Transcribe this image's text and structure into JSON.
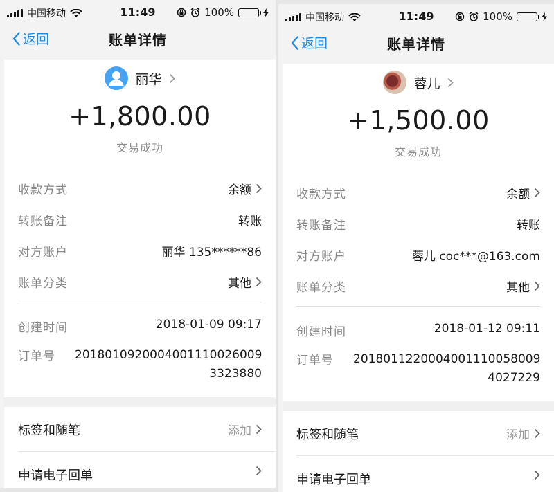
{
  "screens": [
    {
      "status_bar": {
        "carrier": "中国移动",
        "time": "11:49",
        "battery": "100%"
      },
      "nav": {
        "back_label": "返回",
        "title": "账单详情"
      },
      "contact": {
        "name": "丽华"
      },
      "amount": "+1,800.00",
      "status": "交易成功",
      "details": [
        {
          "label": "收款方式",
          "value": "余额"
        },
        {
          "label": "转账备注",
          "value": "转账"
        },
        {
          "label": "对方账户",
          "value": "丽华 135******86"
        },
        {
          "label": "账单分类",
          "value": "其他"
        }
      ],
      "created": {
        "label": "创建时间",
        "value": "2018-01-09 09:17"
      },
      "order": {
        "label": "订单号",
        "line1": "2018010920004001110026009",
        "line2": "3323880"
      },
      "tags": {
        "label": "标签和随笔",
        "action": "添加"
      },
      "receipt": {
        "label": "申请电子回单"
      }
    },
    {
      "status_bar": {
        "carrier": "中国移动",
        "time": "11:49",
        "battery": "100%"
      },
      "nav": {
        "back_label": "返回",
        "title": "账单详情"
      },
      "contact": {
        "name": "蓉儿"
      },
      "amount": "+1,500.00",
      "status": "交易成功",
      "details": [
        {
          "label": "收款方式",
          "value": "余额"
        },
        {
          "label": "转账备注",
          "value": "转账"
        },
        {
          "label": "对方账户",
          "value": "蓉儿 coc***@163.com"
        },
        {
          "label": "账单分类",
          "value": "其他"
        }
      ],
      "created": {
        "label": "创建时间",
        "value": "2018-01-12 09:11"
      },
      "order": {
        "label": "订单号",
        "line1": "2018011220004001110058009",
        "line2": "4027229"
      },
      "tags": {
        "label": "标签和随笔",
        "action": "添加"
      },
      "receipt": {
        "label": "申请电子回单"
      }
    }
  ],
  "colors": {
    "accent": "#1f8ae0",
    "battery": "#3ec24b",
    "avatar_default": "#46a2f4"
  }
}
